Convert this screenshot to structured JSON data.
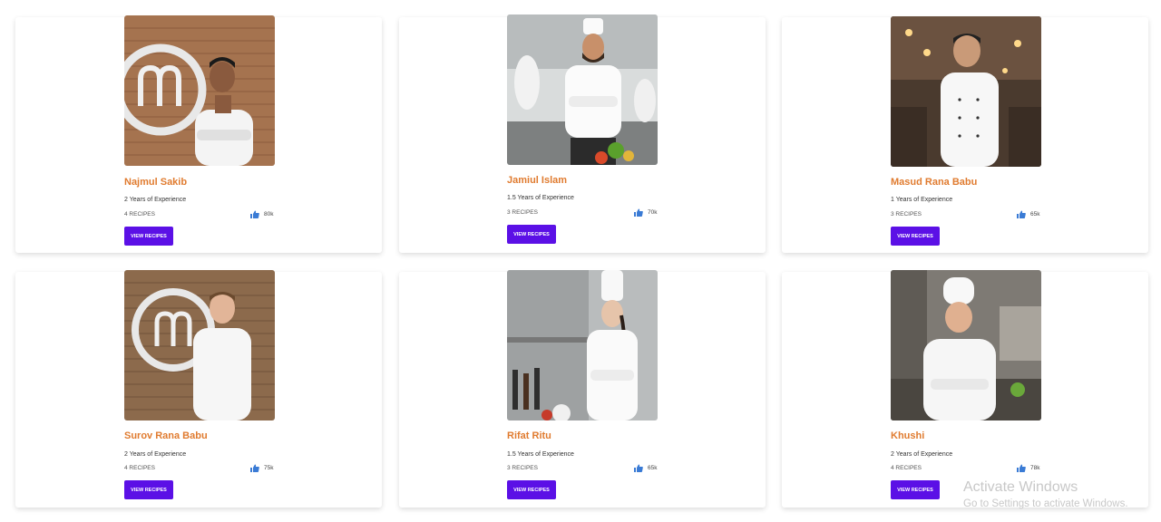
{
  "chefs": [
    {
      "name": "Najmul Sakib",
      "experience": "2 Years of Experience",
      "recipes": "4 RECIPES",
      "likes": "80k",
      "button": "VIEW RECIPES"
    },
    {
      "name": "Jamiul Islam",
      "experience": "1.5 Years of Experience",
      "recipes": "3 RECIPES",
      "likes": "70k",
      "button": "VIEW RECIPES"
    },
    {
      "name": "Masud Rana Babu",
      "experience": "1 Years of Experience",
      "recipes": "3 RECIPES",
      "likes": "65k",
      "button": "VIEW RECIPES"
    },
    {
      "name": "Surov Rana Babu",
      "experience": "2 Years of Experience",
      "recipes": "4 RECIPES",
      "likes": "75k",
      "button": "VIEW RECIPES"
    },
    {
      "name": "Rifat Ritu",
      "experience": "1.5 Years of Experience",
      "recipes": "3 RECIPES",
      "likes": "65k",
      "button": "VIEW RECIPES"
    },
    {
      "name": "Khushi",
      "experience": "2 Years of Experience",
      "recipes": "4 RECIPES",
      "likes": "78k",
      "button": "VIEW RECIPES"
    }
  ],
  "icons": {
    "likes": "thumbs-up-icon"
  },
  "colors": {
    "name": "#e07b2f",
    "button": "#5b10e6",
    "like_icon": "#3a7bd5"
  },
  "watermark": {
    "title": "Activate Windows",
    "subtitle": "Go to Settings to activate Windows."
  }
}
